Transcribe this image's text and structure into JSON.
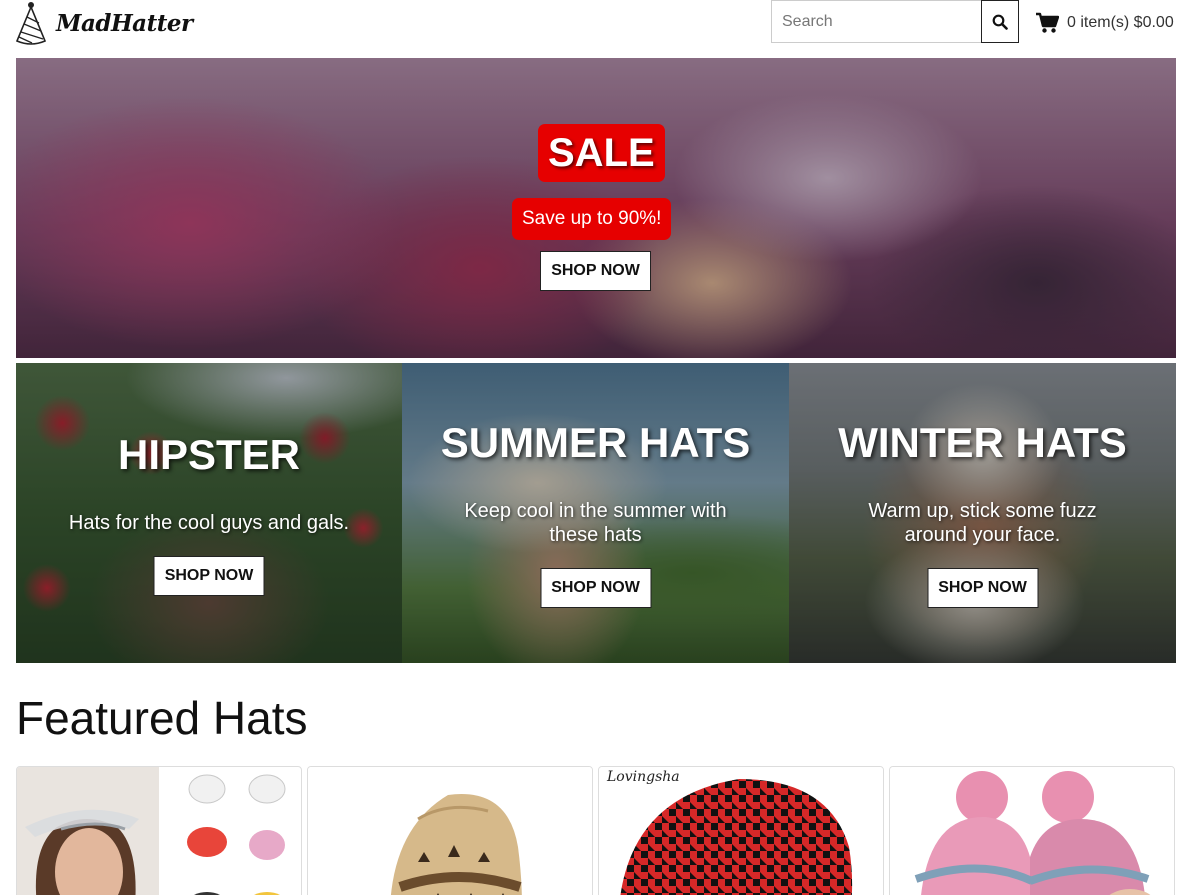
{
  "brand": {
    "name": "MadHatter",
    "logo_icon": "party-hat-icon"
  },
  "search": {
    "placeholder": "Search",
    "value": "",
    "button_icon": "search-icon"
  },
  "cart": {
    "icon": "shopping-cart-icon",
    "label": "0 item(s) $0.00"
  },
  "hero": {
    "badge": "SALE",
    "subtitle": "Save up to 90%!",
    "cta": "SHOP NOW",
    "accent_color": "#e60000"
  },
  "categories": [
    {
      "title": "HIPSTER",
      "description": "Hats for the cool guys and gals.",
      "cta": "SHOP NOW"
    },
    {
      "title": "SUMMER HATS",
      "description": "Keep cool in the summer with these hats",
      "cta": "SHOP NOW"
    },
    {
      "title": "WINTER HATS",
      "description": "Warm up, stick some fuzz around your face.",
      "cta": "SHOP NOW"
    }
  ],
  "featured": {
    "title": "Featured Hats",
    "products": [
      {
        "image": "sun-visor-hats-image"
      },
      {
        "image": "palm-print-fedora-image"
      },
      {
        "image": "houndstooth-beanie-image",
        "caption": "Lovingsha"
      },
      {
        "image": "pink-pompom-beanie-image"
      }
    ]
  }
}
